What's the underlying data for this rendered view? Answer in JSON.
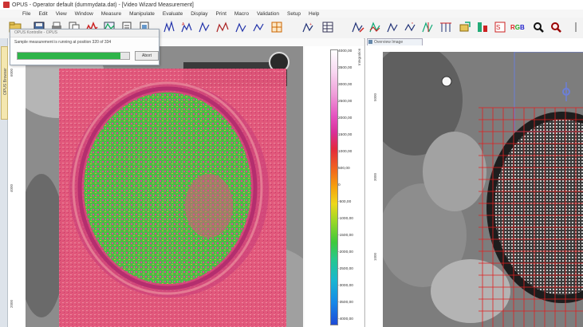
{
  "window": {
    "title": "OPUS - Operator default (dummydata.dat) - [Video Wizard Measurement]"
  },
  "menu": [
    "File",
    "Edit",
    "View",
    "Window",
    "Measure",
    "Manipulate",
    "Evaluate",
    "Display",
    "Print",
    "Macro",
    "Validation",
    "Setup",
    "Help"
  ],
  "sidebar": {
    "tab_label": "OPUS Browser"
  },
  "toolbar": {
    "icons": [
      "open-icon",
      "save-icon",
      "print-icon",
      "copy-icon",
      "spectrum-icon",
      "peak-icon",
      "baseline-icon",
      "integrate-icon",
      "grid-icon",
      "table-icon",
      "chart-icon",
      "map-icon",
      "cube-icon",
      "filter-icon",
      "rgb-icon",
      "zoom-icon",
      "find-icon"
    ]
  },
  "progress_dialog": {
    "title": "OPUS Kontrolle - OPUS",
    "message": "Sample measurement is running at position 320 of 334",
    "progress": 0.92,
    "abort_label": "Abort"
  },
  "left_panel": {
    "ruler_ticks": [
      "6000",
      "4000",
      "2000"
    ],
    "colorbar": {
      "title": "Integration",
      "labels": [
        "4000,00",
        "3500,00",
        "3000,00",
        "2500,00",
        "2000,00",
        "1500,00",
        "1000,00",
        "500,00",
        "0",
        "-500,00",
        "-1000,00",
        "-1500,00",
        "-2000,00",
        "-2500,00",
        "-3000,00",
        "-3500,00",
        "-4000,00"
      ]
    }
  },
  "right_panel": {
    "tab_label": "Overview Image",
    "ruler_ticks": [
      "5000",
      "3000",
      "1000"
    ]
  }
}
